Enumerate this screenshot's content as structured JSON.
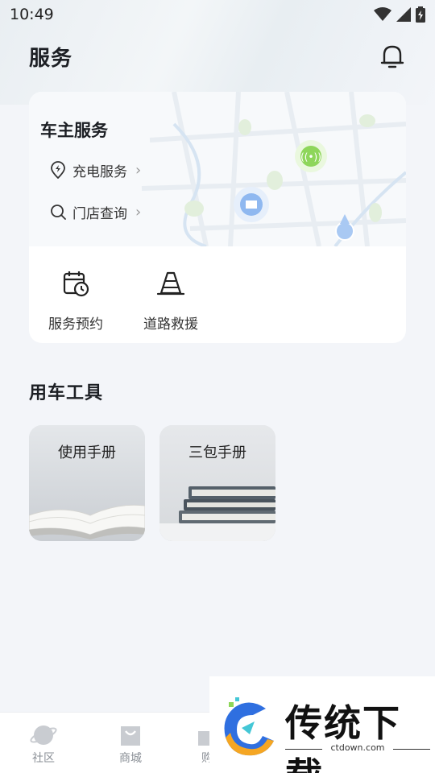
{
  "status_bar": {
    "time": "10:49"
  },
  "header": {
    "title": "服务"
  },
  "owner_services": {
    "title": "车主服务",
    "links": [
      {
        "label": "充电服务",
        "icon": "location-pin-icon"
      },
      {
        "label": "门店查询",
        "icon": "search-icon"
      }
    ],
    "quick_actions": [
      {
        "label": "服务预约",
        "icon": "calendar-clock-icon"
      },
      {
        "label": "道路救援",
        "icon": "traffic-cone-icon"
      }
    ]
  },
  "tools": {
    "title": "用车工具",
    "items": [
      {
        "label": "使用手册"
      },
      {
        "label": "三包手册"
      }
    ]
  },
  "tab_bar": {
    "items": [
      {
        "label": "社区",
        "icon": "planet-icon"
      },
      {
        "label": "商城",
        "icon": "shopping-bag-icon"
      },
      {
        "label": "购",
        "icon": "gift-icon"
      }
    ]
  },
  "ad": {
    "brand": "传统下载",
    "url": "ctdown.com"
  },
  "colors": {
    "accent_blue": "#8fb8f0",
    "charging_green": "#8ed65a",
    "background": "#f3f5f9"
  }
}
